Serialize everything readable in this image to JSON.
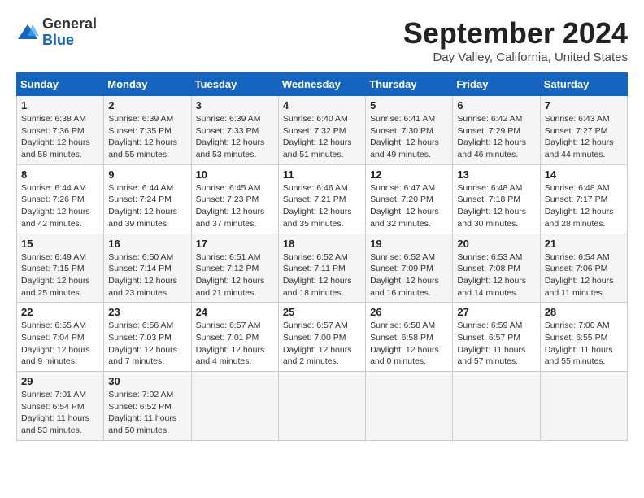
{
  "header": {
    "logo_line1": "General",
    "logo_line2": "Blue",
    "month": "September 2024",
    "location": "Day Valley, California, United States"
  },
  "weekdays": [
    "Sunday",
    "Monday",
    "Tuesday",
    "Wednesday",
    "Thursday",
    "Friday",
    "Saturday"
  ],
  "weeks": [
    [
      {
        "day": "1",
        "info": "Sunrise: 6:38 AM\nSunset: 7:36 PM\nDaylight: 12 hours\nand 58 minutes."
      },
      {
        "day": "2",
        "info": "Sunrise: 6:39 AM\nSunset: 7:35 PM\nDaylight: 12 hours\nand 55 minutes."
      },
      {
        "day": "3",
        "info": "Sunrise: 6:39 AM\nSunset: 7:33 PM\nDaylight: 12 hours\nand 53 minutes."
      },
      {
        "day": "4",
        "info": "Sunrise: 6:40 AM\nSunset: 7:32 PM\nDaylight: 12 hours\nand 51 minutes."
      },
      {
        "day": "5",
        "info": "Sunrise: 6:41 AM\nSunset: 7:30 PM\nDaylight: 12 hours\nand 49 minutes."
      },
      {
        "day": "6",
        "info": "Sunrise: 6:42 AM\nSunset: 7:29 PM\nDaylight: 12 hours\nand 46 minutes."
      },
      {
        "day": "7",
        "info": "Sunrise: 6:43 AM\nSunset: 7:27 PM\nDaylight: 12 hours\nand 44 minutes."
      }
    ],
    [
      {
        "day": "8",
        "info": "Sunrise: 6:44 AM\nSunset: 7:26 PM\nDaylight: 12 hours\nand 42 minutes."
      },
      {
        "day": "9",
        "info": "Sunrise: 6:44 AM\nSunset: 7:24 PM\nDaylight: 12 hours\nand 39 minutes."
      },
      {
        "day": "10",
        "info": "Sunrise: 6:45 AM\nSunset: 7:23 PM\nDaylight: 12 hours\nand 37 minutes."
      },
      {
        "day": "11",
        "info": "Sunrise: 6:46 AM\nSunset: 7:21 PM\nDaylight: 12 hours\nand 35 minutes."
      },
      {
        "day": "12",
        "info": "Sunrise: 6:47 AM\nSunset: 7:20 PM\nDaylight: 12 hours\nand 32 minutes."
      },
      {
        "day": "13",
        "info": "Sunrise: 6:48 AM\nSunset: 7:18 PM\nDaylight: 12 hours\nand 30 minutes."
      },
      {
        "day": "14",
        "info": "Sunrise: 6:48 AM\nSunset: 7:17 PM\nDaylight: 12 hours\nand 28 minutes."
      }
    ],
    [
      {
        "day": "15",
        "info": "Sunrise: 6:49 AM\nSunset: 7:15 PM\nDaylight: 12 hours\nand 25 minutes."
      },
      {
        "day": "16",
        "info": "Sunrise: 6:50 AM\nSunset: 7:14 PM\nDaylight: 12 hours\nand 23 minutes."
      },
      {
        "day": "17",
        "info": "Sunrise: 6:51 AM\nSunset: 7:12 PM\nDaylight: 12 hours\nand 21 minutes."
      },
      {
        "day": "18",
        "info": "Sunrise: 6:52 AM\nSunset: 7:11 PM\nDaylight: 12 hours\nand 18 minutes."
      },
      {
        "day": "19",
        "info": "Sunrise: 6:52 AM\nSunset: 7:09 PM\nDaylight: 12 hours\nand 16 minutes."
      },
      {
        "day": "20",
        "info": "Sunrise: 6:53 AM\nSunset: 7:08 PM\nDaylight: 12 hours\nand 14 minutes."
      },
      {
        "day": "21",
        "info": "Sunrise: 6:54 AM\nSunset: 7:06 PM\nDaylight: 12 hours\nand 11 minutes."
      }
    ],
    [
      {
        "day": "22",
        "info": "Sunrise: 6:55 AM\nSunset: 7:04 PM\nDaylight: 12 hours\nand 9 minutes."
      },
      {
        "day": "23",
        "info": "Sunrise: 6:56 AM\nSunset: 7:03 PM\nDaylight: 12 hours\nand 7 minutes."
      },
      {
        "day": "24",
        "info": "Sunrise: 6:57 AM\nSunset: 7:01 PM\nDaylight: 12 hours\nand 4 minutes."
      },
      {
        "day": "25",
        "info": "Sunrise: 6:57 AM\nSunset: 7:00 PM\nDaylight: 12 hours\nand 2 minutes."
      },
      {
        "day": "26",
        "info": "Sunrise: 6:58 AM\nSunset: 6:58 PM\nDaylight: 12 hours\nand 0 minutes."
      },
      {
        "day": "27",
        "info": "Sunrise: 6:59 AM\nSunset: 6:57 PM\nDaylight: 11 hours\nand 57 minutes."
      },
      {
        "day": "28",
        "info": "Sunrise: 7:00 AM\nSunset: 6:55 PM\nDaylight: 11 hours\nand 55 minutes."
      }
    ],
    [
      {
        "day": "29",
        "info": "Sunrise: 7:01 AM\nSunset: 6:54 PM\nDaylight: 11 hours\nand 53 minutes."
      },
      {
        "day": "30",
        "info": "Sunrise: 7:02 AM\nSunset: 6:52 PM\nDaylight: 11 hours\nand 50 minutes."
      },
      {
        "day": "",
        "info": ""
      },
      {
        "day": "",
        "info": ""
      },
      {
        "day": "",
        "info": ""
      },
      {
        "day": "",
        "info": ""
      },
      {
        "day": "",
        "info": ""
      }
    ]
  ]
}
